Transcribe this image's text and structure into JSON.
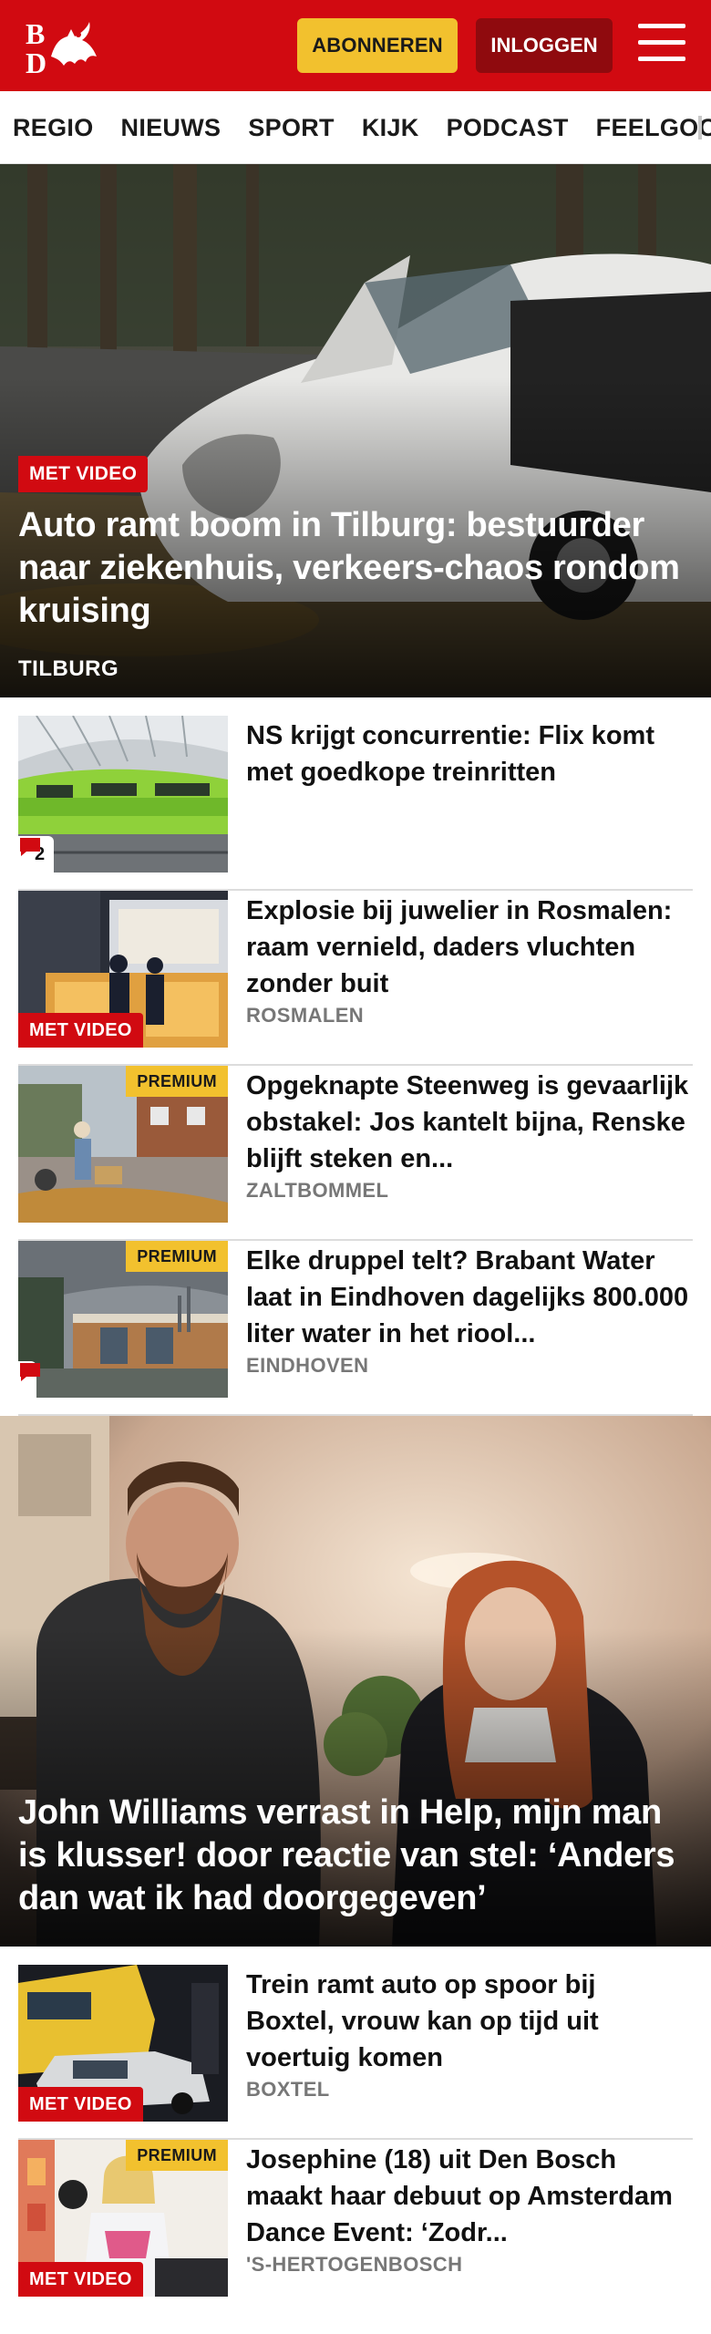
{
  "header": {
    "logo_text": "BD",
    "subscribe_label": "ABONNEREN",
    "login_label": "INLOGGEN",
    "brand_red": "#d10a11",
    "accent_yellow": "#f2c12e"
  },
  "nav": {
    "items": [
      {
        "label": "REGIO"
      },
      {
        "label": "NIEUWS"
      },
      {
        "label": "SPORT"
      },
      {
        "label": "KIJK"
      },
      {
        "label": "PODCAST"
      },
      {
        "label": "FEELGOOD"
      }
    ]
  },
  "articles": [
    {
      "kind": "hero",
      "badge": "MET VIDEO",
      "title": "Auto ramt boom in Tilburg: bestuurder naar ziekenhuis, verkeers-chaos rondom kruising",
      "location": "TILBURG",
      "image_icon": "crashed-car-image"
    },
    {
      "kind": "list",
      "title": "NS krijgt concurrentie: Flix komt met goedkope treinritten",
      "comments": "2",
      "image_icon": "green-train-image"
    },
    {
      "kind": "list",
      "badge": "MET VIDEO",
      "title": "Explosie bij juwelier in Rosmalen: raam vernield, daders vluchten zonder buit",
      "location": "ROSMALEN",
      "image_icon": "jeweler-storefront-image"
    },
    {
      "kind": "list",
      "premium": "PREMIUM",
      "title": "Opgeknapte Steenweg is gevaarlijk obstakel: Jos kantelt bijna, Renske blijft steken en...",
      "location": "ZALTBOMMEL",
      "image_icon": "street-scene-image"
    },
    {
      "kind": "list",
      "premium": "PREMIUM",
      "title": "Elke druppel telt? Brabant Water laat in Eindhoven dagelijks 800.000 liter water in het riool...",
      "location": "EINDHOVEN",
      "image_icon": "water-building-image"
    },
    {
      "kind": "hero",
      "title": "John Williams verrast in Help, mijn man is klusser! door reactie van stel: ‘Anders dan wat ik had doorgegeven’",
      "image_icon": "couple-portrait-image"
    },
    {
      "kind": "list",
      "badge": "MET VIDEO",
      "title": "Trein ramt auto op spoor bij Boxtel, vrouw kan op tijd uit voertuig komen",
      "location": "BOXTEL",
      "image_icon": "train-car-collision-image"
    },
    {
      "kind": "list",
      "badge": "MET VIDEO",
      "premium": "PREMIUM",
      "title": "Josephine (18) uit Den Bosch maakt haar debuut op Amsterdam Dance Event: ‘Zodr...",
      "location": "'S-HERTOGENBOSCH",
      "image_icon": "dj-girl-image"
    }
  ]
}
